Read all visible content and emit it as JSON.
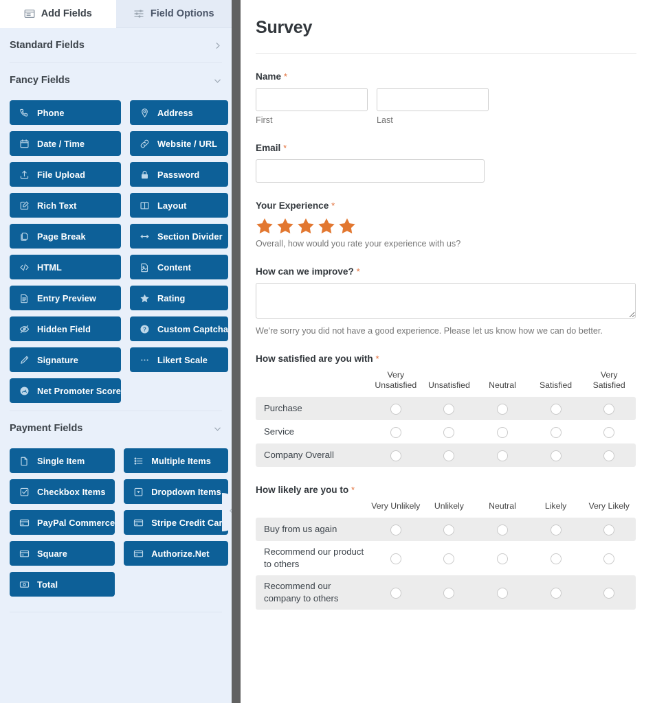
{
  "panel": {
    "tabs": [
      {
        "label": "Add Fields",
        "icon": "add-fields-icon",
        "active": true
      },
      {
        "label": "Field Options",
        "icon": "sliders-icon",
        "active": false
      }
    ],
    "sections": [
      {
        "id": "standard",
        "title": "Standard Fields",
        "state": "collapsed",
        "chevron": "chevron-right-icon",
        "fields": []
      },
      {
        "id": "fancy",
        "title": "Fancy Fields",
        "state": "expanded",
        "chevron": "chevron-down-icon",
        "fields": [
          {
            "label": "Phone",
            "icon": "phone-icon"
          },
          {
            "label": "Address",
            "icon": "map-pin-icon"
          },
          {
            "label": "Date / Time",
            "icon": "calendar-icon"
          },
          {
            "label": "Website / URL",
            "icon": "link-icon"
          },
          {
            "label": "File Upload",
            "icon": "upload-icon"
          },
          {
            "label": "Password",
            "icon": "lock-icon"
          },
          {
            "label": "Rich Text",
            "icon": "pencil-square-icon"
          },
          {
            "label": "Layout",
            "icon": "columns-icon"
          },
          {
            "label": "Page Break",
            "icon": "pages-icon"
          },
          {
            "label": "Section Divider",
            "icon": "arrows-horizontal-icon"
          },
          {
            "label": "HTML",
            "icon": "code-icon"
          },
          {
            "label": "Content",
            "icon": "document-image-icon"
          },
          {
            "label": "Entry Preview",
            "icon": "file-lines-icon"
          },
          {
            "label": "Rating",
            "icon": "star-icon"
          },
          {
            "label": "Hidden Field",
            "icon": "eye-slash-icon"
          },
          {
            "label": "Custom Captcha",
            "icon": "question-circle-icon"
          },
          {
            "label": "Signature",
            "icon": "pen-icon"
          },
          {
            "label": "Likert Scale",
            "icon": "dots-icon"
          },
          {
            "label": "Net Promoter Score",
            "icon": "gauge-icon"
          }
        ]
      },
      {
        "id": "payment",
        "title": "Payment Fields",
        "state": "expanded",
        "chevron": "chevron-down-icon",
        "fields": [
          {
            "label": "Single Item",
            "icon": "file-icon"
          },
          {
            "label": "Multiple Items",
            "icon": "list-icon"
          },
          {
            "label": "Checkbox Items",
            "icon": "checkbox-icon"
          },
          {
            "label": "Dropdown Items",
            "icon": "dropdown-icon"
          },
          {
            "label": "PayPal Commerce",
            "icon": "credit-card-icon"
          },
          {
            "label": "Stripe Credit Card",
            "icon": "credit-card-icon"
          },
          {
            "label": "Square",
            "icon": "credit-card-icon"
          },
          {
            "label": "Authorize.Net",
            "icon": "credit-card-icon"
          },
          {
            "label": "Total",
            "icon": "money-icon"
          }
        ]
      }
    ],
    "collapse_handle_icon": "chevron-left-icon"
  },
  "form": {
    "title": "Survey",
    "required_mark": "*",
    "fields": {
      "name": {
        "label": "Name",
        "required": true,
        "first": {
          "value": "",
          "sublabel": "First"
        },
        "last": {
          "value": "",
          "sublabel": "Last"
        }
      },
      "email": {
        "label": "Email",
        "required": true,
        "value": ""
      },
      "experience": {
        "label": "Your Experience",
        "required": true,
        "stars": 5,
        "star_color": "#e27730",
        "description": "Overall, how would you rate your experience with us?"
      },
      "improve": {
        "label": "How can we improve?",
        "required": true,
        "value": "",
        "description": "We're sorry you did not have a good experience. Please let us know how we can do better."
      },
      "satisfied": {
        "label": "How satisfied are you with",
        "required": true,
        "columns": [
          "Very Unsatisfied",
          "Unsatisfied",
          "Neutral",
          "Satisfied",
          "Very Satisfied"
        ],
        "rows": [
          "Purchase",
          "Service",
          "Company Overall"
        ]
      },
      "likely": {
        "label": "How likely are you to",
        "required": true,
        "columns": [
          "Very Unlikely",
          "Unlikely",
          "Neutral",
          "Likely",
          "Very Likely"
        ],
        "rows": [
          "Buy from us again",
          "Recommend our product to others",
          "Recommend our company to others"
        ]
      }
    }
  },
  "colors": {
    "field_button_blue": "#0d6098",
    "sidebar_bg": "#e9f0fa",
    "accent_orange": "#e27730",
    "splitter_gray": "#616161",
    "likert_stripe": "#ececec"
  }
}
